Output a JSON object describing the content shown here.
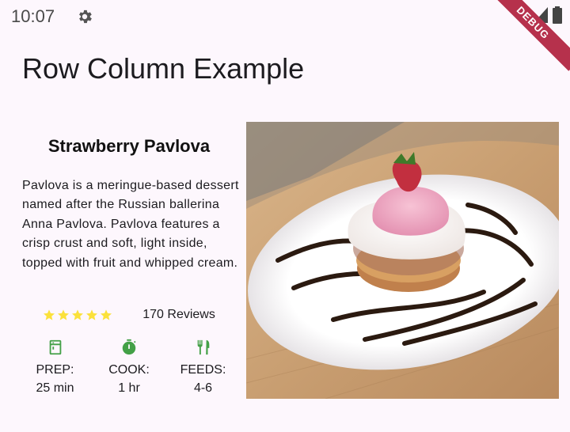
{
  "status_bar": {
    "time": "10:07",
    "debug_banner": "DEBUG"
  },
  "app_bar": {
    "title": "Row Column Example"
  },
  "recipe": {
    "title": "Strawberry Pavlova",
    "description": "Pavlova is a meringue-based dessert named after the Russian ballerina Anna Pavlova. Pavlova features a crisp crust and soft, light inside, topped with fruit and whipped cream.",
    "rating_stars": 5,
    "reviews": "170 Reviews",
    "info": [
      {
        "icon": "kitchen-icon",
        "label": "PREP:",
        "value": "25 min"
      },
      {
        "icon": "timer-icon",
        "label": "COOK:",
        "value": "1 hr"
      },
      {
        "icon": "restaurant-icon",
        "label": "FEEDS:",
        "value": "4-6"
      }
    ],
    "image": "pavlova-photo"
  },
  "colors": {
    "star": "#fbe13b",
    "icon_green": "#43a047",
    "background": "#fdf7fd",
    "debug_ribbon": "#b6314c"
  }
}
